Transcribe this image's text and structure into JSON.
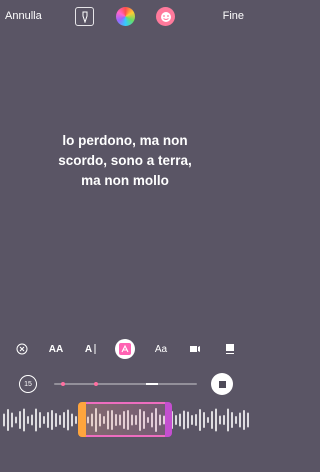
{
  "header": {
    "cancel_label": "Annulla",
    "done_label": "Fine"
  },
  "lyrics": {
    "lines": [
      "lo perdono, ma non",
      "scordo, sono a terra,",
      "ma non mollo"
    ]
  },
  "tools": {
    "text_size_label": "AA",
    "text_style_label": "A",
    "font_preview_label": "Aa"
  },
  "scrubber": {
    "duration_label": "15"
  },
  "colors": {
    "background": "#5a5565",
    "accent_pink": "#ee6dbf",
    "accent_orange": "#ffa53d"
  }
}
